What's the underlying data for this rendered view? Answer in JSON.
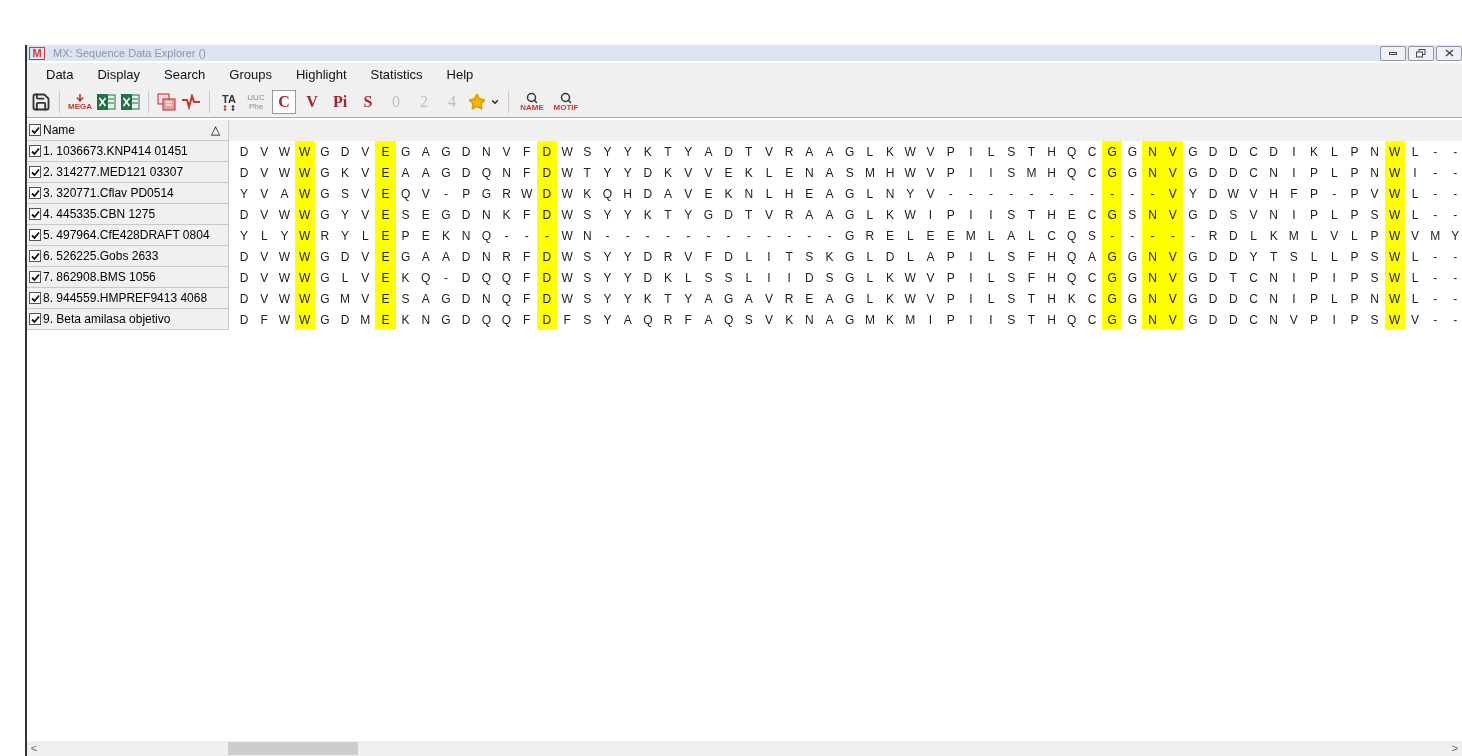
{
  "window": {
    "logo": "M",
    "title": "MX: Sequence Data Explorer ()"
  },
  "menu": [
    "Data",
    "Display",
    "Search",
    "Groups",
    "Highlight",
    "Statistics",
    "Help"
  ],
  "toolbar": {
    "export_label": "MEGA",
    "case_label": "TA",
    "codon": {
      "top": "UUC",
      "bottom": "Phe",
      "disabled": true
    },
    "site_buttons": [
      {
        "label": "C",
        "selected": true,
        "disabled": false
      },
      {
        "label": "V",
        "selected": false,
        "disabled": false
      },
      {
        "label": "Pi",
        "selected": false,
        "disabled": false
      },
      {
        "label": "S",
        "selected": false,
        "disabled": false
      },
      {
        "label": "0",
        "selected": false,
        "disabled": true
      },
      {
        "label": "2",
        "selected": false,
        "disabled": true
      },
      {
        "label": "4",
        "selected": false,
        "disabled": true
      }
    ],
    "find_labels": [
      "NAME",
      "MOTIF"
    ]
  },
  "table": {
    "header": {
      "label": "Name",
      "checked": true,
      "sort_mark": "△"
    },
    "sites": [
      {
        "highlighted": false
      },
      {
        "highlighted": false
      },
      {
        "highlighted": false
      },
      {
        "highlighted": true
      },
      {
        "highlighted": false
      },
      {
        "highlighted": false
      },
      {
        "highlighted": false
      },
      {
        "highlighted": true
      },
      {
        "highlighted": false
      },
      {
        "highlighted": false
      },
      {
        "highlighted": false
      },
      {
        "highlighted": false
      },
      {
        "highlighted": false
      },
      {
        "highlighted": false
      },
      {
        "highlighted": false
      },
      {
        "highlighted": true
      },
      {
        "highlighted": false
      },
      {
        "highlighted": false
      },
      {
        "highlighted": false
      },
      {
        "highlighted": false
      },
      {
        "highlighted": false
      },
      {
        "highlighted": false
      },
      {
        "highlighted": false
      },
      {
        "highlighted": false
      },
      {
        "highlighted": false
      },
      {
        "highlighted": false
      },
      {
        "highlighted": false
      },
      {
        "highlighted": false
      },
      {
        "highlighted": false
      },
      {
        "highlighted": false
      },
      {
        "highlighted": false
      },
      {
        "highlighted": false
      },
      {
        "highlighted": false
      },
      {
        "highlighted": false
      },
      {
        "highlighted": false
      },
      {
        "highlighted": false
      },
      {
        "highlighted": false
      },
      {
        "highlighted": false
      },
      {
        "highlighted": false
      },
      {
        "highlighted": false
      },
      {
        "highlighted": false
      },
      {
        "highlighted": false
      },
      {
        "highlighted": false
      },
      {
        "highlighted": true
      },
      {
        "highlighted": false
      },
      {
        "highlighted": true
      },
      {
        "highlighted": true
      },
      {
        "highlighted": false
      },
      {
        "highlighted": false
      },
      {
        "highlighted": false
      },
      {
        "highlighted": false
      },
      {
        "highlighted": false
      },
      {
        "highlighted": false
      },
      {
        "highlighted": false
      },
      {
        "highlighted": false
      },
      {
        "highlighted": false
      },
      {
        "highlighted": false
      },
      {
        "highlighted": true
      },
      {
        "highlighted": false
      },
      {
        "highlighted": false
      },
      {
        "highlighted": false
      }
    ],
    "rows": [
      {
        "name": "1. 1036673.KNP414 01451",
        "checked": true,
        "residues": [
          "D",
          "V",
          "W",
          "W",
          "G",
          "D",
          "V",
          "E",
          "G",
          "A",
          "G",
          "D",
          "N",
          "V",
          "F",
          "D",
          "W",
          "S",
          "Y",
          "Y",
          "K",
          "T",
          "Y",
          "A",
          "D",
          "T",
          "V",
          "R",
          "A",
          "A",
          "G",
          "L",
          "K",
          "W",
          "V",
          "P",
          "I",
          "L",
          "S",
          "T",
          "H",
          "Q",
          "C",
          "G",
          "G",
          "N",
          "V",
          "G",
          "D",
          "D",
          "C",
          "D",
          "I",
          "K",
          "L",
          "P",
          "N",
          "W",
          "L",
          "-",
          "-"
        ]
      },
      {
        "name": "2. 314277.MED121 03307",
        "checked": true,
        "residues": [
          "D",
          "V",
          "W",
          "W",
          "G",
          "K",
          "V",
          "E",
          "A",
          "A",
          "G",
          "D",
          "Q",
          "N",
          "F",
          "D",
          "W",
          "T",
          "Y",
          "Y",
          "D",
          "K",
          "V",
          "V",
          "E",
          "K",
          "L",
          "E",
          "N",
          "A",
          "S",
          "M",
          "H",
          "W",
          "V",
          "P",
          "I",
          "I",
          "S",
          "M",
          "H",
          "Q",
          "C",
          "G",
          "G",
          "N",
          "V",
          "G",
          "D",
          "D",
          "C",
          "N",
          "I",
          "P",
          "L",
          "P",
          "N",
          "W",
          "I",
          "-",
          "-"
        ]
      },
      {
        "name": "3. 320771.Cflav PD0514",
        "checked": true,
        "residues": [
          "Y",
          "V",
          "A",
          "W",
          "G",
          "S",
          "V",
          "E",
          "Q",
          "V",
          "-",
          "P",
          "G",
          "R",
          "W",
          "D",
          "W",
          "K",
          "Q",
          "H",
          "D",
          "A",
          "V",
          "E",
          "K",
          "N",
          "L",
          "H",
          "E",
          "A",
          "G",
          "L",
          "N",
          "Y",
          "V",
          "-",
          "-",
          "-",
          "-",
          "-",
          "-",
          "-",
          "-",
          "-",
          "-",
          "-",
          "V",
          "Y",
          "D",
          "W",
          "V",
          "H",
          "F",
          "P",
          "-",
          "P",
          "V",
          "W",
          "L",
          "-",
          "-"
        ]
      },
      {
        "name": "4. 445335.CBN 1275",
        "checked": true,
        "residues": [
          "D",
          "V",
          "W",
          "W",
          "G",
          "Y",
          "V",
          "E",
          "S",
          "E",
          "G",
          "D",
          "N",
          "K",
          "F",
          "D",
          "W",
          "S",
          "Y",
          "Y",
          "K",
          "T",
          "Y",
          "G",
          "D",
          "T",
          "V",
          "R",
          "A",
          "A",
          "G",
          "L",
          "K",
          "W",
          "I",
          "P",
          "I",
          "I",
          "S",
          "T",
          "H",
          "E",
          "C",
          "G",
          "S",
          "N",
          "V",
          "G",
          "D",
          "S",
          "V",
          "N",
          "I",
          "P",
          "L",
          "P",
          "S",
          "W",
          "L",
          "-",
          "-"
        ]
      },
      {
        "name": "5. 497964.CfE428DRAFT 0804",
        "checked": true,
        "residues": [
          "Y",
          "L",
          "Y",
          "W",
          "R",
          "Y",
          "L",
          "E",
          "P",
          "E",
          "K",
          "N",
          "Q",
          "-",
          "-",
          "-",
          "W",
          "N",
          "-",
          "-",
          "-",
          "-",
          "-",
          "-",
          "-",
          "-",
          "-",
          "-",
          "-",
          "-",
          "G",
          "R",
          "E",
          "L",
          "E",
          "E",
          "M",
          "L",
          "A",
          "L",
          "C",
          "Q",
          "S",
          "-",
          "-",
          "-",
          "-",
          "-",
          "R",
          "D",
          "L",
          "K",
          "M",
          "L",
          "V",
          "L",
          "P",
          "W",
          "V",
          "M",
          "Y"
        ]
      },
      {
        "name": "6. 526225.Gobs 2633",
        "checked": true,
        "residues": [
          "D",
          "V",
          "W",
          "W",
          "G",
          "D",
          "V",
          "E",
          "G",
          "A",
          "A",
          "D",
          "N",
          "R",
          "F",
          "D",
          "W",
          "S",
          "Y",
          "Y",
          "D",
          "R",
          "V",
          "F",
          "D",
          "L",
          "I",
          "T",
          "S",
          "K",
          "G",
          "L",
          "D",
          "L",
          "A",
          "P",
          "I",
          "L",
          "S",
          "F",
          "H",
          "Q",
          "A",
          "G",
          "G",
          "N",
          "V",
          "G",
          "D",
          "D",
          "Y",
          "T",
          "S",
          "L",
          "L",
          "P",
          "S",
          "W",
          "L",
          "-",
          "-"
        ]
      },
      {
        "name": "7. 862908.BMS 1056",
        "checked": true,
        "residues": [
          "D",
          "V",
          "W",
          "W",
          "G",
          "L",
          "V",
          "E",
          "K",
          "Q",
          "-",
          "D",
          "Q",
          "Q",
          "F",
          "D",
          "W",
          "S",
          "Y",
          "Y",
          "D",
          "K",
          "L",
          "S",
          "S",
          "L",
          "I",
          "I",
          "D",
          "S",
          "G",
          "L",
          "K",
          "W",
          "V",
          "P",
          "I",
          "L",
          "S",
          "F",
          "H",
          "Q",
          "C",
          "G",
          "G",
          "N",
          "V",
          "G",
          "D",
          "T",
          "C",
          "N",
          "I",
          "P",
          "I",
          "P",
          "S",
          "W",
          "L",
          "-",
          "-"
        ]
      },
      {
        "name": "8. 944559.HMPREF9413 4068",
        "checked": true,
        "residues": [
          "D",
          "V",
          "W",
          "W",
          "G",
          "M",
          "V",
          "E",
          "S",
          "A",
          "G",
          "D",
          "N",
          "Q",
          "F",
          "D",
          "W",
          "S",
          "Y",
          "Y",
          "K",
          "T",
          "Y",
          "A",
          "G",
          "A",
          "V",
          "R",
          "E",
          "A",
          "G",
          "L",
          "K",
          "W",
          "V",
          "P",
          "I",
          "L",
          "S",
          "T",
          "H",
          "K",
          "C",
          "G",
          "G",
          "N",
          "V",
          "G",
          "D",
          "D",
          "C",
          "N",
          "I",
          "P",
          "L",
          "P",
          "N",
          "W",
          "L",
          "-",
          "-"
        ]
      },
      {
        "name": "9. Beta amilasa objetivo",
        "checked": true,
        "residues": [
          "D",
          "F",
          "W",
          "W",
          "G",
          "D",
          "M",
          "E",
          "K",
          "N",
          "G",
          "D",
          "Q",
          "Q",
          "F",
          "D",
          "F",
          "S",
          "Y",
          "A",
          "Q",
          "R",
          "F",
          "A",
          "Q",
          "S",
          "V",
          "K",
          "N",
          "A",
          "G",
          "M",
          "K",
          "M",
          "I",
          "P",
          "I",
          "I",
          "S",
          "T",
          "H",
          "Q",
          "C",
          "G",
          "G",
          "N",
          "V",
          "G",
          "D",
          "D",
          "C",
          "N",
          "V",
          "P",
          "I",
          "P",
          "S",
          "W",
          "V",
          "-",
          "-"
        ]
      }
    ]
  },
  "scrollbar": {
    "left": "<",
    "right": ">"
  }
}
